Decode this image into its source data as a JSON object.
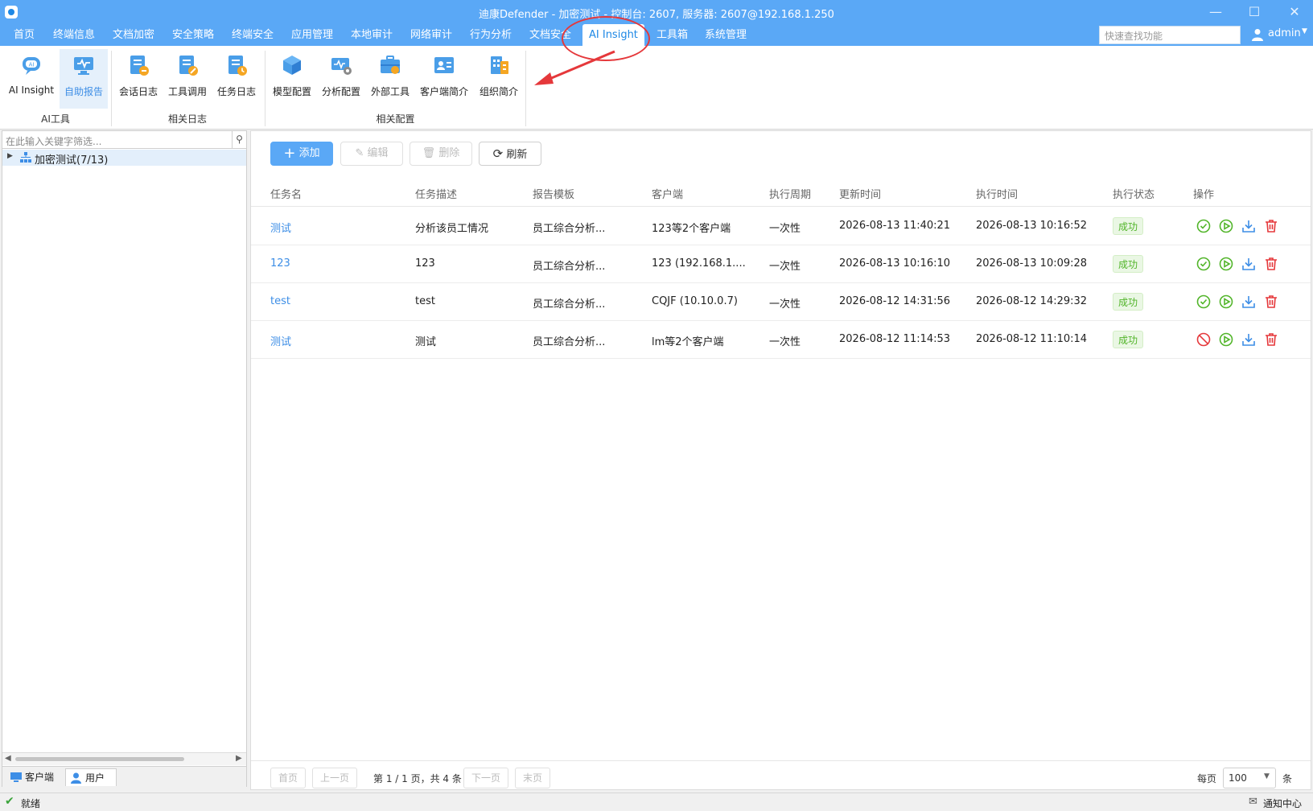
{
  "window": {
    "title": "迪康Defender - 加密测试 - 控制台: 2607, 服务器: 2607@192.168.1.250"
  },
  "menu": {
    "items": [
      "首页",
      "终端信息",
      "文档加密",
      "安全策略",
      "终端安全",
      "应用管理",
      "本地审计",
      "网络审计",
      "行为分析",
      "文档安全",
      "AI Insight",
      "工具箱",
      "系统管理"
    ],
    "active": "AI Insight",
    "search_placeholder": "快速查找功能",
    "user": "admin"
  },
  "ribbon": {
    "buttons": [
      "AI Insight",
      "自助报告",
      "会话日志",
      "工具调用",
      "任务日志",
      "模型配置",
      "分析配置",
      "外部工具",
      "客户端简介",
      "组织简介"
    ],
    "selected": "自助报告",
    "groups": [
      "AI工具",
      "相关日志",
      "相关配置"
    ]
  },
  "left_panel": {
    "search_placeholder": "在此输入关键字筛选...",
    "tree_root": "加密测试(7/13)",
    "tabs": [
      "客户端",
      "用户"
    ],
    "active_tab": "用户"
  },
  "toolbar": {
    "add": "添加",
    "edit": "编辑",
    "delete": "删除",
    "refresh": "刷新"
  },
  "table": {
    "columns": [
      "任务名",
      "任务描述",
      "报告模板",
      "客户端",
      "执行周期",
      "更新时间",
      "执行时间",
      "执行状态",
      "操作"
    ],
    "rows": [
      {
        "name": "测试",
        "desc": "分析该员工情况",
        "template": "员工综合分析...",
        "client": "123等2个客户端",
        "period": "一次性",
        "updated": "2026-08-13 11:40:21",
        "executed": "2026-08-13 10:16:52",
        "status": "成功",
        "first_action": "check"
      },
      {
        "name": "123",
        "desc": "123",
        "template": "员工综合分析...",
        "client": "123 (192.168.1....",
        "period": "一次性",
        "updated": "2026-08-13 10:16:10",
        "executed": "2026-08-13 10:09:28",
        "status": "成功",
        "first_action": "check"
      },
      {
        "name": "test",
        "desc": "test",
        "template": "员工综合分析...",
        "client": "CQJF (10.10.0.7)",
        "period": "一次性",
        "updated": "2026-08-12 14:31:56",
        "executed": "2026-08-12 14:29:32",
        "status": "成功",
        "first_action": "check"
      },
      {
        "name": "测试",
        "desc": "测试",
        "template": "员工综合分析...",
        "client": "lm等2个客户端",
        "period": "一次性",
        "updated": "2026-08-12 11:14:53",
        "executed": "2026-08-12 11:10:14",
        "status": "成功",
        "first_action": "ban"
      }
    ]
  },
  "pager": {
    "first": "首页",
    "prev": "上一页",
    "info": "第 1 / 1 页，共 4 条",
    "next": "下一页",
    "last": "末页",
    "per_page_label": "每页",
    "per_page": "100",
    "unit": "条"
  },
  "statusbar": {
    "status": "就绪",
    "notify": "通知中心"
  },
  "colors": {
    "accent": "#5aa8f6",
    "link": "#3d8ee6",
    "success": "#52b52a",
    "danger": "#e5383b"
  }
}
